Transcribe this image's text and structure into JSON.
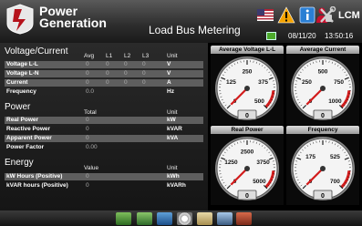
{
  "header": {
    "brand_line1": "Power",
    "brand_line2": "Generation",
    "title": "Load Bus Metering",
    "device": "LCM",
    "date": "08/11/20",
    "time": "13:50:16",
    "icons": [
      "flag-icon",
      "warning-icon",
      "info-icon",
      "user-icon",
      "tools-icon"
    ]
  },
  "voltage_current": {
    "title": "Voltage/Current",
    "columns": [
      "Avg",
      "L1",
      "L2",
      "L3",
      "Unit"
    ],
    "rows": [
      {
        "label": "Voltage L-L",
        "avg": "0",
        "l1": "0",
        "l2": "0",
        "l3": "0",
        "unit": "V"
      },
      {
        "label": "Voltage L-N",
        "avg": "0",
        "l1": "0",
        "l2": "0",
        "l3": "0",
        "unit": "V"
      },
      {
        "label": "Current",
        "avg": "0",
        "l1": "0",
        "l2": "0",
        "l3": "0",
        "unit": "A"
      },
      {
        "label": "Frequency",
        "avg": "0.0",
        "l1": "",
        "l2": "",
        "l3": "",
        "unit": "Hz"
      }
    ]
  },
  "power": {
    "title": "Power",
    "columns": [
      "Total",
      "Unit"
    ],
    "rows": [
      {
        "label": "Real Power",
        "total": "0",
        "unit": "kW"
      },
      {
        "label": "Reactive Power",
        "total": "0",
        "unit": "kVAR"
      },
      {
        "label": "Apparent Power",
        "total": "0",
        "unit": "kVA"
      },
      {
        "label": "Power Factor",
        "total": "0.00",
        "unit": ""
      }
    ]
  },
  "energy": {
    "title": "Energy",
    "columns": [
      "Value",
      "Unit"
    ],
    "rows": [
      {
        "label": "kW Hours (Positive)",
        "value": "0",
        "unit": "kWh"
      },
      {
        "label": "kVAR hours (Positive)",
        "value": "0",
        "unit": "kVARh"
      }
    ]
  },
  "gauges": [
    {
      "title": "Average Voltage L-L",
      "ticks": [
        "0",
        "125",
        "250",
        "375",
        "500"
      ],
      "reading": "0",
      "value": 0,
      "max": 500
    },
    {
      "title": "Average Current",
      "ticks": [
        "0",
        "250",
        "500",
        "750",
        "1000"
      ],
      "reading": "0",
      "value": 0,
      "max": 1000
    },
    {
      "title": "Real Power",
      "ticks": [
        "0",
        "1250",
        "2500",
        "3750",
        "5000"
      ],
      "reading": "0",
      "value": 0,
      "max": 5000
    },
    {
      "title": "Frequency",
      "ticks": [
        "0",
        "175",
        "525",
        "700"
      ],
      "reading": "0",
      "value": 0,
      "max": 700
    }
  ],
  "footer": {
    "icons": [
      "generator-icon",
      "trend-icon",
      "alarm-log-icon",
      "setup-icon",
      "document-icon",
      "network-icon",
      "exit-icon"
    ]
  }
}
